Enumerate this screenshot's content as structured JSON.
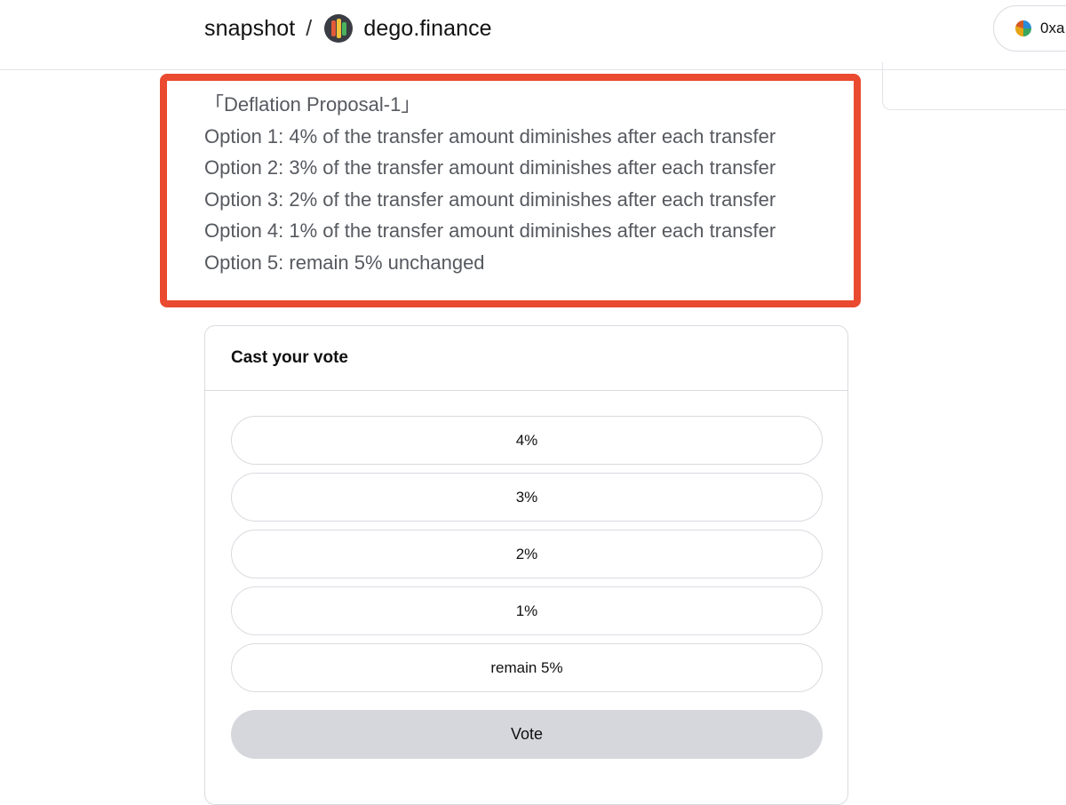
{
  "header": {
    "app_name": "snapshot",
    "separator": "/",
    "space_name": "dego.finance",
    "account_text": "0xa"
  },
  "proposal": {
    "lines": [
      "「Deflation Proposal-1」",
      "Option 1: 4% of the transfer amount diminishes after each transfer",
      "Option 2: 3% of the transfer amount diminishes after each transfer",
      "Option 3: 2% of the transfer amount diminishes after each transfer",
      "Option 4: 1% of the transfer amount diminishes after each transfer",
      "Option 5: remain 5% unchanged"
    ]
  },
  "vote": {
    "title": "Cast your vote",
    "choices": [
      "4%",
      "3%",
      "2%",
      "1%",
      "remain 5%"
    ],
    "button_label": "Vote"
  },
  "colors": {
    "highlight": "#ea4a2f",
    "body_text": "#56595f",
    "vote_button_bg": "#d5d7dc",
    "border": "#d9dbe0"
  },
  "icons": {
    "space_avatar": "dego-logo-icon",
    "account_avatar": "account-avatar-icon"
  }
}
